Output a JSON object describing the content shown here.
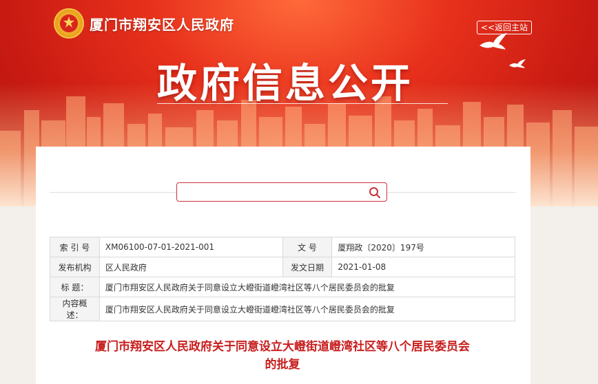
{
  "header": {
    "site_name": "厦门市翔安区人民政府",
    "back_home": "<<返回主站",
    "big_title": "政府信息公开"
  },
  "search": {
    "placeholder": ""
  },
  "meta": {
    "index_label": "索 引 号",
    "index_value": "XM06100-07-01-2021-001",
    "docno_label": "文 号",
    "docno_value": "厦翔政〔2020〕197号",
    "publisher_label": "发布机构",
    "publisher_value": "区人民政府",
    "date_label": "发文日期",
    "date_value": "2021-01-08",
    "title_label": "标 题：",
    "title_value": "厦门市翔安区人民政府关于同意设立大嶝街道嶝湾社区等八个居民委员会的批复",
    "summary_label": "内容概述：",
    "summary_value": "厦门市翔安区人民政府关于同意设立大嶝街道嶝湾社区等八个居民委员会的批复"
  },
  "document": {
    "title_line1": "厦门市翔安区人民政府关于同意设立大嶝街道嶝湾社区等八个居民委员会",
    "title_line2": "的批复"
  },
  "colors": {
    "banner_red": "#e8311c",
    "doc_title_red": "#c81d1d",
    "search_border": "#c8323a"
  }
}
